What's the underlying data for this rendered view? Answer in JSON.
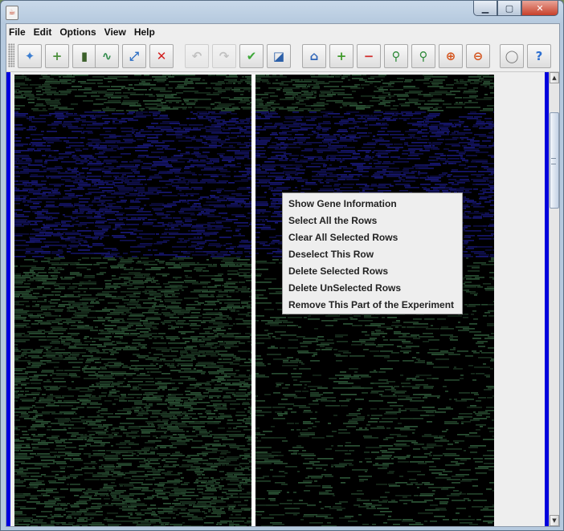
{
  "window": {
    "app_icon": "java-cup-icon",
    "controls": [
      {
        "name": "minimize",
        "icon": "minimize-icon",
        "glyph": "▁"
      },
      {
        "name": "maximize",
        "icon": "maximize-icon",
        "glyph": "▢"
      },
      {
        "name": "close",
        "icon": "close-icon",
        "glyph": "✕"
      }
    ]
  },
  "menubar": {
    "items": [
      "File",
      "Edit",
      "Options",
      "View",
      "Help"
    ]
  },
  "toolbar": {
    "buttons": [
      {
        "name": "new-icon",
        "glyph": "✦",
        "color": "#3d7fd1",
        "enabled": true
      },
      {
        "name": "add-file-icon",
        "glyph": "+",
        "color": "#4a8f3a",
        "enabled": true
      },
      {
        "name": "heatmap-icon",
        "glyph": "▮",
        "color": "#3b5f2a",
        "enabled": true
      },
      {
        "name": "line-chart-icon",
        "glyph": "∿",
        "color": "#2f8a4a",
        "enabled": true
      },
      {
        "name": "expand-icon",
        "glyph": "⤢",
        "color": "#2d6fc4",
        "enabled": true
      },
      {
        "name": "delete-icon",
        "glyph": "✕",
        "color": "#d21f1f",
        "enabled": true
      },
      {
        "name": "undo-icon",
        "glyph": "↶",
        "color": "#8a8a8a",
        "enabled": false
      },
      {
        "name": "redo-icon",
        "glyph": "↷",
        "color": "#8a8a8a",
        "enabled": false
      },
      {
        "name": "check-icon",
        "glyph": "✔",
        "color": "#3fa83a",
        "enabled": true
      },
      {
        "name": "image-icon",
        "glyph": "◪",
        "color": "#2b5fa8",
        "enabled": true
      },
      {
        "name": "home-icon",
        "glyph": "⌂",
        "color": "#2e64b8",
        "enabled": true
      },
      {
        "name": "add-icon",
        "glyph": "+",
        "color": "#3f9a2a",
        "enabled": true
      },
      {
        "name": "remove-icon",
        "glyph": "−",
        "color": "#d22a2a",
        "enabled": true
      },
      {
        "name": "zoom-in-icon",
        "glyph": "⚲",
        "color": "#2f8a3a",
        "enabled": true
      },
      {
        "name": "zoom-out-icon",
        "glyph": "⚲",
        "color": "#2f8a3a",
        "enabled": true
      },
      {
        "name": "cluster-in-icon",
        "glyph": "⊕",
        "color": "#d4531c",
        "enabled": true
      },
      {
        "name": "cluster-out-icon",
        "glyph": "⊖",
        "color": "#d4531c",
        "enabled": true
      },
      {
        "name": "lightbulb-icon",
        "glyph": "◯",
        "color": "#777777",
        "enabled": true
      },
      {
        "name": "help-icon",
        "glyph": "?",
        "color": "#2d6fd0",
        "enabled": true
      }
    ]
  },
  "heatmap": {
    "colors": {
      "background": "#000000",
      "green": "#2f5a3a",
      "blue": "#1a1a80",
      "selection": "#0000dd"
    },
    "selected_band": "rows 45-227 highlighted in blue (selected)"
  },
  "context_menu": {
    "items": [
      "Show Gene Information",
      "Select All the Rows",
      "Clear All Selected Rows",
      "Deselect This Row",
      "Delete Selected Rows",
      "Delete UnSelected Rows",
      "Remove This Part of the Experiment"
    ]
  }
}
